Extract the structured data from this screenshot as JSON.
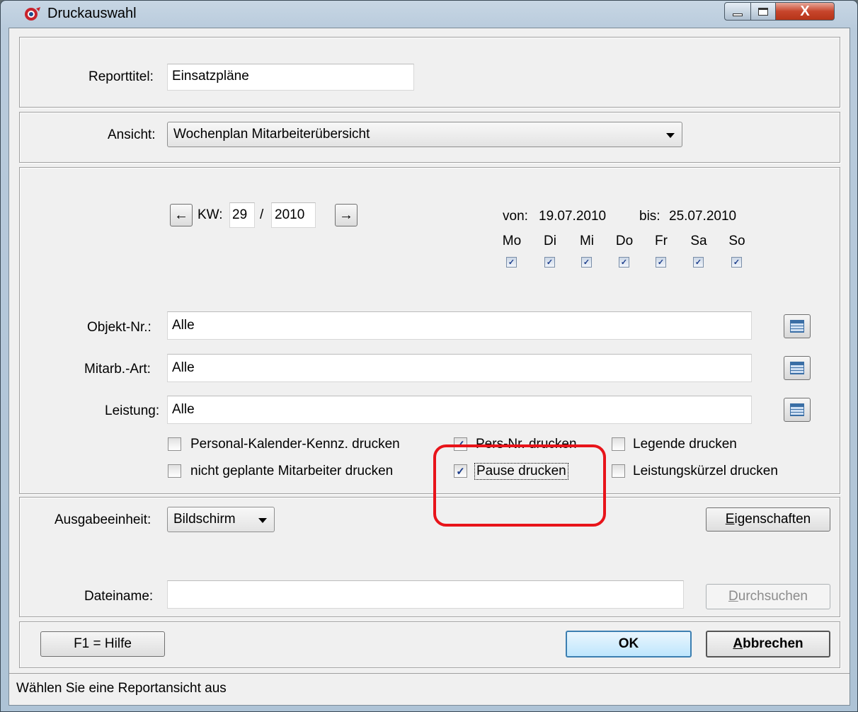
{
  "window": {
    "title": "Druckauswahl",
    "close_label": "X"
  },
  "report": {
    "title_label": "Reporttitel:",
    "title_value": "Einsatzpläne"
  },
  "view": {
    "label": "Ansicht:",
    "selected": "Wochenplan Mitarbeiterübersicht"
  },
  "week": {
    "prev_icon": "arrow-left-icon",
    "next_icon": "arrow-right-icon",
    "kw_label": "KW:",
    "kw_value": "29",
    "separator": "/",
    "year_value": "2010",
    "from_label": "von:",
    "from_value": "19.07.2010",
    "to_label": "bis:",
    "to_value": "25.07.2010",
    "days": [
      {
        "label": "Mo",
        "checked": true
      },
      {
        "label": "Di",
        "checked": true
      },
      {
        "label": "Mi",
        "checked": true
      },
      {
        "label": "Do",
        "checked": true
      },
      {
        "label": "Fr",
        "checked": true
      },
      {
        "label": "Sa",
        "checked": true
      },
      {
        "label": "So",
        "checked": true
      }
    ]
  },
  "filters": {
    "object_label": "Objekt-Nr.:",
    "object_value": "Alle",
    "type_label": "Mitarb.-Art:",
    "type_value": "Alle",
    "service_label": "Leistung:",
    "service_value": "Alle"
  },
  "options": {
    "personal_calendar": {
      "label": "Personal-Kalender-Kennz. drucken",
      "checked": false
    },
    "unplanned": {
      "label": "nicht geplante Mitarbeiter drucken",
      "checked": false
    },
    "pers_nr": {
      "label": "Pers-Nr. drucken",
      "checked": true
    },
    "pause": {
      "label": "Pause drucken",
      "checked": true
    },
    "legend": {
      "label": "Legende drucken",
      "checked": false
    },
    "service_abbr": {
      "label": "Leistungskürzel drucken",
      "checked": false
    }
  },
  "output": {
    "unit_label": "Ausgabeeinheit:",
    "unit_value": "Bildschirm",
    "properties_button": "Eigenschaften",
    "properties_first": "E",
    "properties_rest": "igenschaften",
    "filename_label": "Dateiname:",
    "filename_value": "",
    "browse_first": "D",
    "browse_rest": "urchsuchen"
  },
  "footer": {
    "help_button": "F1 = Hilfe",
    "ok_button": "OK",
    "cancel_first": "A",
    "cancel_rest": "bbrechen"
  },
  "status": {
    "text": "Wählen Sie eine Reportansicht aus"
  },
  "colors": {
    "highlight": "#e8141a",
    "checkmark": "#1a3c8b"
  }
}
